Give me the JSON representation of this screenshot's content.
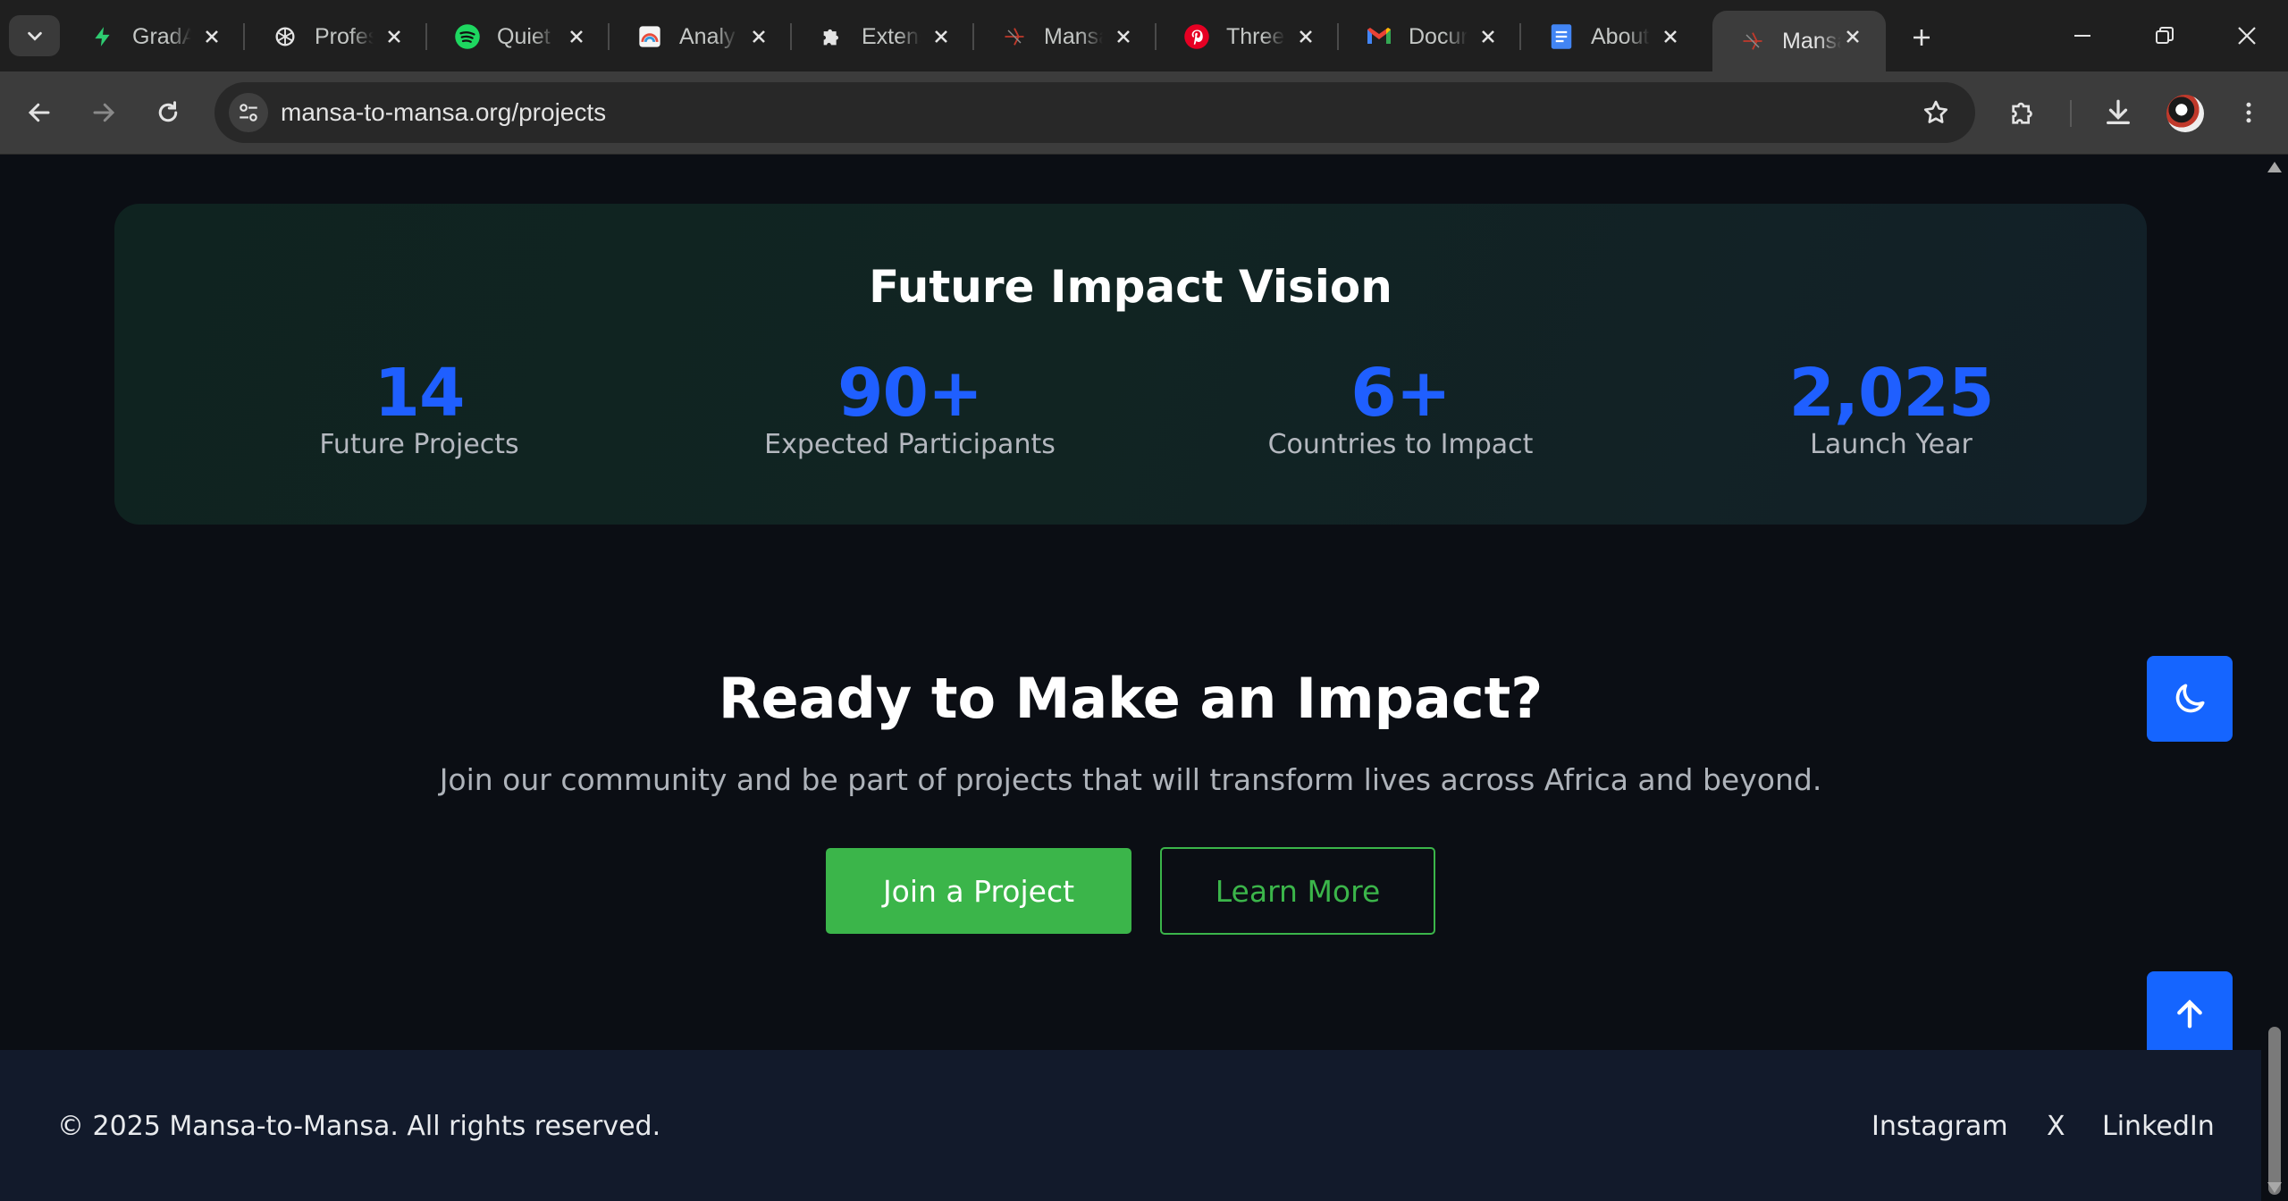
{
  "browser": {
    "tabs": [
      {
        "title": "GradA",
        "icon": "bolt-icon",
        "active": false
      },
      {
        "title": "Profes",
        "icon": "openai-icon",
        "active": false
      },
      {
        "title": "Quiet",
        "icon": "spotify-icon",
        "active": false
      },
      {
        "title": "Analy",
        "icon": "analytics-icon",
        "active": false
      },
      {
        "title": "Extens",
        "icon": "puzzle-icon",
        "active": false
      },
      {
        "title": "Mansa",
        "icon": "mansa-icon",
        "active": false
      },
      {
        "title": "Three",
        "icon": "pinterest-icon",
        "active": false
      },
      {
        "title": "Docur",
        "icon": "gmail-icon",
        "active": false
      },
      {
        "title": "About",
        "icon": "docs-icon",
        "active": false
      },
      {
        "title": "Mansa",
        "icon": "mansa-icon",
        "active": true
      }
    ],
    "url": "mansa-to-mansa.org/projects"
  },
  "vision": {
    "title": "Future Impact Vision",
    "stats": [
      {
        "value": "14",
        "label": "Future Projects"
      },
      {
        "value": "90+",
        "label": "Expected Participants"
      },
      {
        "value": "6+",
        "label": "Countries to Impact"
      },
      {
        "value": "2,025",
        "label": "Launch Year"
      }
    ]
  },
  "cta": {
    "title": "Ready to Make an Impact?",
    "subtitle": "Join our community and be part of projects that will transform lives across Africa and beyond.",
    "primary_label": "Join a Project",
    "secondary_label": "Learn More"
  },
  "footer": {
    "copyright": "© 2025 Mansa-to-Mansa. All rights reserved.",
    "links": [
      "Instagram",
      "X",
      "LinkedIn"
    ]
  },
  "colors": {
    "accent_blue": "#1f5fff",
    "cta_green": "#3bb54a",
    "fab_blue": "#1565ff",
    "page_bg": "#0b0e14",
    "footer_bg": "#121a2b"
  }
}
